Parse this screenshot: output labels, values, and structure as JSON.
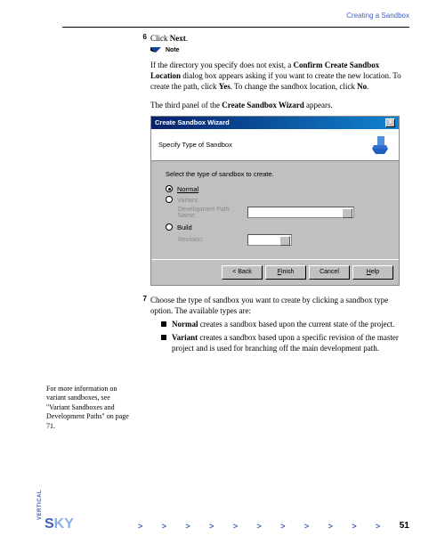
{
  "header": {
    "title": "Creating a Sandbox"
  },
  "steps": {
    "s6": {
      "num": "6",
      "text_pre": "Click ",
      "bold": "Next",
      "text_post": "."
    },
    "s7": {
      "num": "7",
      "text": "Choose the type of sandbox you want to create by clicking a sandbox type option. The available types are:",
      "bullets": {
        "b1": {
          "bold": "Normal",
          "rest": " creates a sandbox based upon the current state of the project."
        },
        "b2": {
          "bold": "Variant",
          "rest": " creates a sandbox based upon a specific revision of the master project and is used for branching off the main development path."
        }
      }
    }
  },
  "note": {
    "label": "Note",
    "body_pre": "If the directory you specify does not exist, a ",
    "bold1": "Confirm Create Sandbox Location",
    "mid1": " dialog box appears asking if you want to create the new location. To create the path, click ",
    "bold2": "Yes",
    "mid2": ". To change the sandbox location, click ",
    "bold3": "No",
    "end": "."
  },
  "intro": {
    "pre": "The third panel of the ",
    "bold": "Create Sandbox Wizard",
    "post": " appears."
  },
  "wizard": {
    "title": "Create Sandbox Wizard",
    "close": "×",
    "header": "Specify Type of Sandbox",
    "instruction": "Select the type of sandbox to create.",
    "opts": {
      "normal": "Normal",
      "variant": "Variant",
      "variant_sub": "Development Path Name:",
      "build": "Build",
      "build_sub": "Revision:"
    },
    "buttons": {
      "back": "< Back",
      "finish": "Finish",
      "cancel": "Cancel",
      "help": "Help"
    }
  },
  "sidenote": "For more information on variant sandboxes, see \"Variant Sandboxes and Development Paths\" on page 71.",
  "footer": {
    "logo_vertical": "VERTICAL",
    "logo_s": "S",
    "logo_ky": "KY",
    "chevron": ">",
    "page": "51"
  }
}
